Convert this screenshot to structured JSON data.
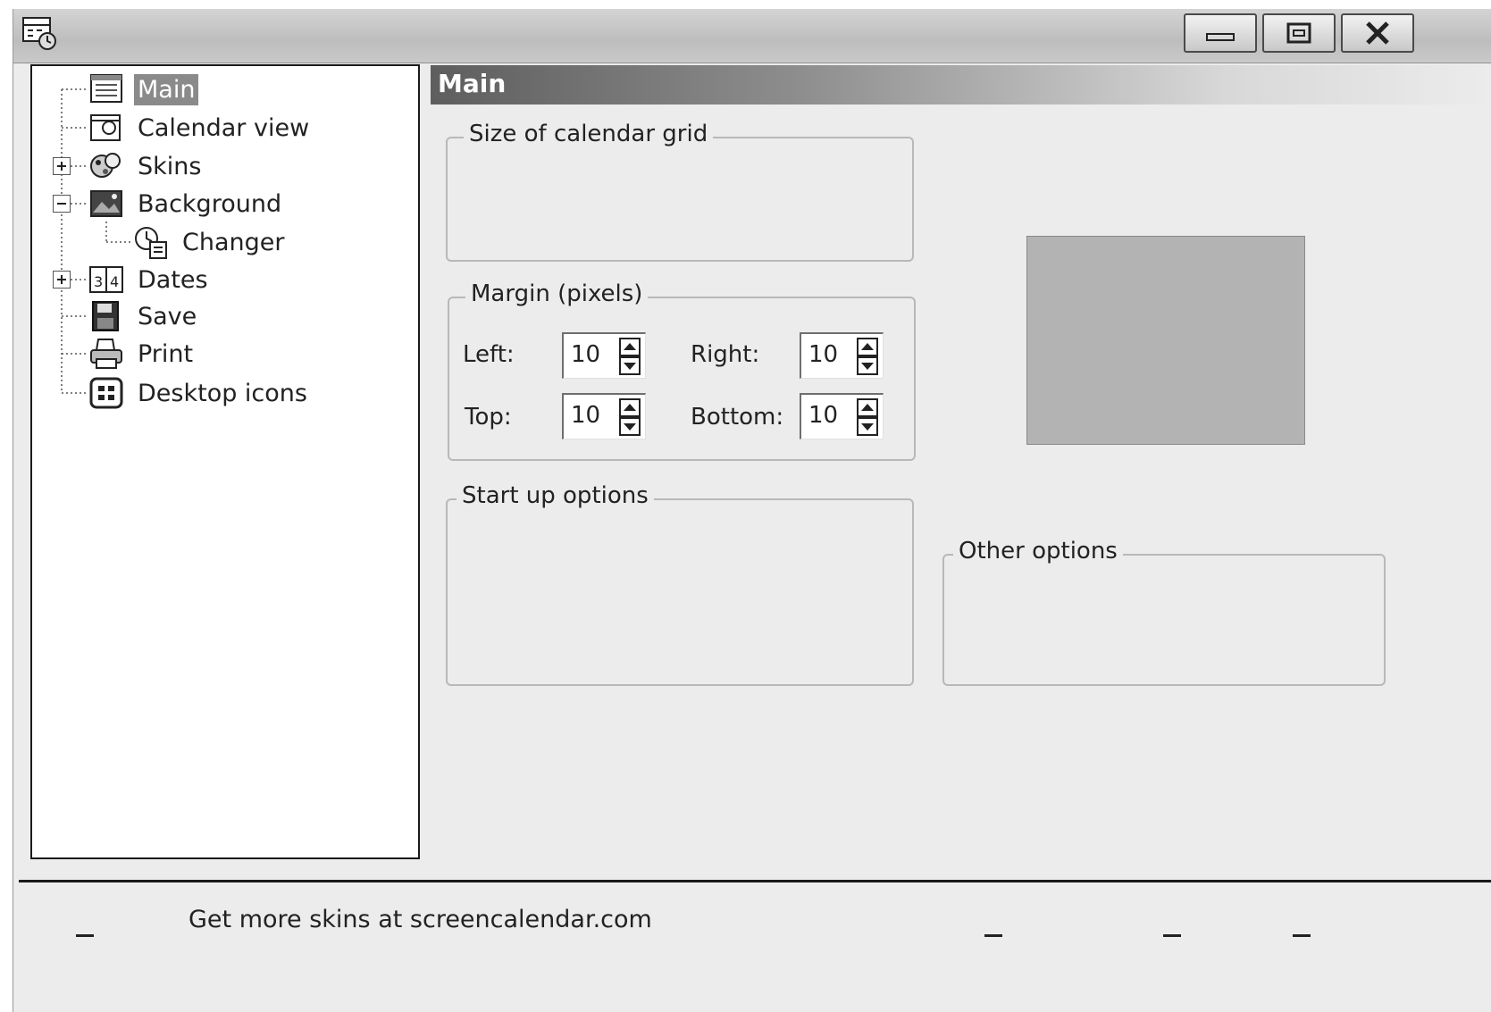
{
  "titlebar": {
    "app_icon": "calendar-app-icon",
    "minimize_icon": "minimize-icon",
    "maximize_icon": "maximize-icon",
    "close_icon": "close-icon"
  },
  "tree": {
    "items": [
      {
        "label": "Main",
        "icon": "main-page-icon",
        "selected": true
      },
      {
        "label": "Calendar view",
        "icon": "calendar-view-icon"
      },
      {
        "label": "Skins",
        "icon": "skins-icon",
        "expander": "+"
      },
      {
        "label": "Background",
        "icon": "background-icon",
        "expander": "-"
      },
      {
        "label": "Changer",
        "icon": "changer-icon"
      },
      {
        "label": "Dates",
        "icon": "dates-icon",
        "expander": "+"
      },
      {
        "label": "Save",
        "icon": "floppy-disk-icon"
      },
      {
        "label": "Print",
        "icon": "printer-icon"
      },
      {
        "label": "Desktop icons",
        "icon": "desktop-icons-icon"
      }
    ]
  },
  "main": {
    "header": "Main",
    "size_group": {
      "legend": "Size of calendar grid"
    },
    "margin_group": {
      "legend": "Margin (pixels)",
      "left_label": "Left:",
      "left_value": "10",
      "right_label": "Right:",
      "right_value": "10",
      "top_label": "Top:",
      "top_value": "10",
      "bottom_label": "Bottom:",
      "bottom_value": "10"
    },
    "startup_group": {
      "legend": "Start up options"
    },
    "other_group": {
      "legend": "Other options"
    }
  },
  "status": {
    "text": "Get more skins at screencalendar.com"
  }
}
